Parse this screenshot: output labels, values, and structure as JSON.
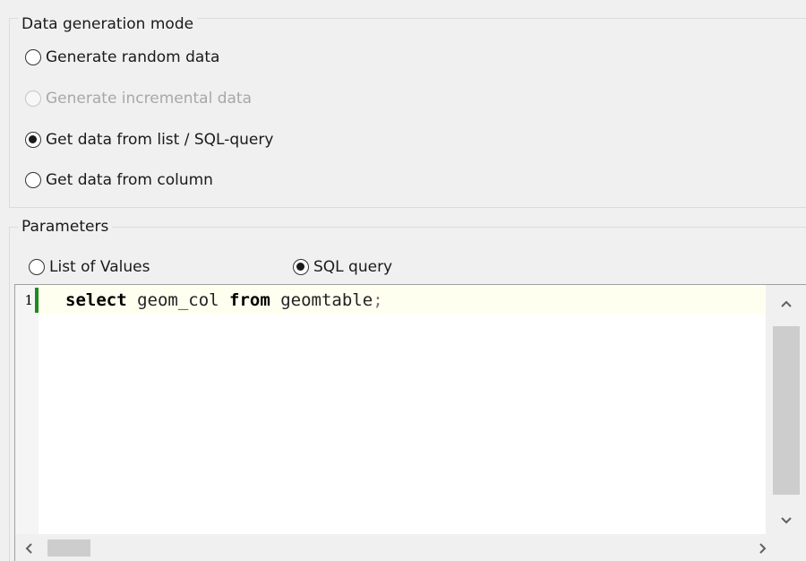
{
  "mode_group": {
    "title": "Data generation mode",
    "options": [
      {
        "label": "Generate random data",
        "selected": false,
        "enabled": true
      },
      {
        "label": "Generate incremental data",
        "selected": false,
        "enabled": false
      },
      {
        "label": "Get data from list / SQL-query",
        "selected": true,
        "enabled": true
      },
      {
        "label": "Get data from column",
        "selected": false,
        "enabled": true
      }
    ]
  },
  "params_group": {
    "title": "Parameters",
    "source_options": [
      {
        "label": "List of Values",
        "selected": false
      },
      {
        "label": "SQL query",
        "selected": true
      }
    ]
  },
  "editor": {
    "line_number": "1",
    "code_tokens": {
      "kw1": "select",
      "t1": " geom_col ",
      "kw2": "from",
      "t2": " geomtable",
      "punc": ";"
    },
    "icons": {
      "scroll_up": "chevron-up-icon",
      "scroll_down": "chevron-down-icon",
      "scroll_left": "chevron-left-icon",
      "scroll_right": "chevron-right-icon"
    },
    "current_line_color": "#fffff0",
    "gutter_marker_color": "#1e8a1e"
  }
}
